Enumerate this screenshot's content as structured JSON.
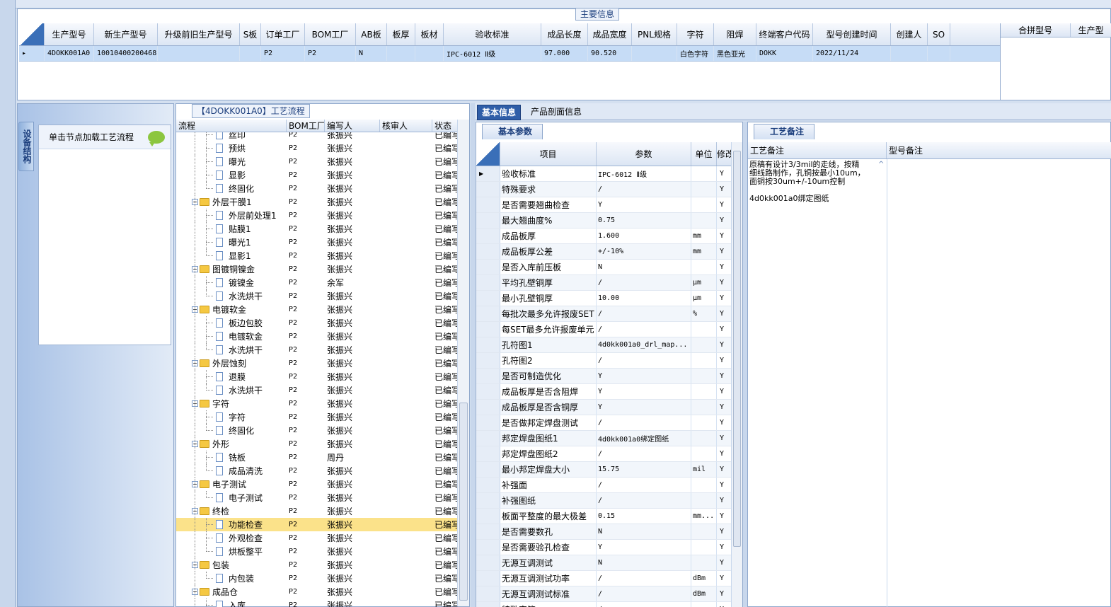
{
  "main_info": {
    "title": "主要信息",
    "columns": [
      "",
      "生产型号",
      "新生产型号",
      "升级前旧生产型号",
      "S板",
      "订单工厂",
      "BOM工厂",
      "AB板",
      "板厚",
      "板材",
      "验收标准",
      "成品长度",
      "成品宽度",
      "PNL规格",
      "字符",
      "阻焊",
      "终端客户代码",
      "型号创建时间",
      "创建人",
      "SO"
    ],
    "row": [
      "▸",
      "4DOKK001A0",
      "10010400200468",
      "",
      "",
      "P2",
      "P2",
      "N",
      "",
      "",
      "IPC-6012 Ⅱ级",
      "97.000",
      "90.520",
      "",
      "白色字符",
      "黑色亚光",
      "DOKK",
      "2022/11/24",
      "",
      ""
    ],
    "merge_columns": [
      "合拼型号",
      "生产型"
    ]
  },
  "device_structure": {
    "tab_label": "设备结构",
    "hint": "单击节点加载工艺流程"
  },
  "process": {
    "title": "【4DOKK001A0】工艺流程",
    "columns": [
      "流程",
      "BOM工厂",
      "编写人",
      "核审人",
      "状态"
    ],
    "rows": [
      {
        "name": "丝印",
        "level": 2,
        "type": "doc",
        "bom": "P2",
        "writer": "张振兴",
        "status": "已编写"
      },
      {
        "name": "预烘",
        "level": 2,
        "type": "doc",
        "bom": "P2",
        "writer": "张振兴",
        "status": "已编写"
      },
      {
        "name": "曝光",
        "level": 2,
        "type": "doc",
        "bom": "P2",
        "writer": "张振兴",
        "status": "已编写"
      },
      {
        "name": "显影",
        "level": 2,
        "type": "doc",
        "bom": "P2",
        "writer": "张振兴",
        "status": "已编写"
      },
      {
        "name": "终固化",
        "level": 2,
        "type": "doc",
        "last": true,
        "bom": "P2",
        "writer": "张振兴",
        "status": "已编写"
      },
      {
        "name": "外层干膜1",
        "level": 1,
        "type": "folder",
        "bom": "P2",
        "writer": "张振兴",
        "status": "已编写"
      },
      {
        "name": "外层前处理1",
        "level": 2,
        "type": "doc",
        "bom": "P2",
        "writer": "张振兴",
        "status": "已编写"
      },
      {
        "name": "贴膜1",
        "level": 2,
        "type": "doc",
        "bom": "P2",
        "writer": "张振兴",
        "status": "已编写"
      },
      {
        "name": "曝光1",
        "level": 2,
        "type": "doc",
        "bom": "P2",
        "writer": "张振兴",
        "status": "已编写"
      },
      {
        "name": "显影1",
        "level": 2,
        "type": "doc",
        "last": true,
        "bom": "P2",
        "writer": "张振兴",
        "status": "已编写"
      },
      {
        "name": "图镀铜镍金",
        "level": 1,
        "type": "folder",
        "bom": "P2",
        "writer": "张振兴",
        "status": "已编写"
      },
      {
        "name": "镀镍金",
        "level": 2,
        "type": "doc",
        "bom": "P2",
        "writer": "余军",
        "status": "已编写"
      },
      {
        "name": "水洗烘干",
        "level": 2,
        "type": "doc",
        "last": true,
        "bom": "P2",
        "writer": "张振兴",
        "status": "已编写"
      },
      {
        "name": "电镀软金",
        "level": 1,
        "type": "folder",
        "bom": "P2",
        "writer": "张振兴",
        "status": "已编写"
      },
      {
        "name": "板边包胶",
        "level": 2,
        "type": "doc",
        "bom": "P2",
        "writer": "张振兴",
        "status": "已编写"
      },
      {
        "name": "电镀软金",
        "level": 2,
        "type": "doc",
        "bom": "P2",
        "writer": "张振兴",
        "status": "已编写"
      },
      {
        "name": "水洗烘干",
        "level": 2,
        "type": "doc",
        "last": true,
        "bom": "P2",
        "writer": "张振兴",
        "status": "已编写"
      },
      {
        "name": "外层蚀刻",
        "level": 1,
        "type": "folder",
        "bom": "P2",
        "writer": "张振兴",
        "status": "已编写"
      },
      {
        "name": "退膜",
        "level": 2,
        "type": "doc",
        "bom": "P2",
        "writer": "张振兴",
        "status": "已编写"
      },
      {
        "name": "水洗烘干",
        "level": 2,
        "type": "doc",
        "last": true,
        "bom": "P2",
        "writer": "张振兴",
        "status": "已编写"
      },
      {
        "name": "字符",
        "level": 1,
        "type": "folder",
        "bom": "P2",
        "writer": "张振兴",
        "status": "已编写"
      },
      {
        "name": "字符",
        "level": 2,
        "type": "doc",
        "bom": "P2",
        "writer": "张振兴",
        "status": "已编写"
      },
      {
        "name": "终固化",
        "level": 2,
        "type": "doc",
        "last": true,
        "bom": "P2",
        "writer": "张振兴",
        "status": "已编写"
      },
      {
        "name": "外形",
        "level": 1,
        "type": "folder",
        "bom": "P2",
        "writer": "张振兴",
        "status": "已编写"
      },
      {
        "name": "铣板",
        "level": 2,
        "type": "doc",
        "bom": "P2",
        "writer": "周丹",
        "status": "已编写"
      },
      {
        "name": "成品清洗",
        "level": 2,
        "type": "doc",
        "last": true,
        "bom": "P2",
        "writer": "张振兴",
        "status": "已编写"
      },
      {
        "name": "电子测试",
        "level": 1,
        "type": "folder",
        "bom": "P2",
        "writer": "张振兴",
        "status": "已编写"
      },
      {
        "name": "电子测试",
        "level": 2,
        "type": "doc",
        "last": true,
        "bom": "P2",
        "writer": "张振兴",
        "status": "已编写"
      },
      {
        "name": "终检",
        "level": 1,
        "type": "folder",
        "bom": "P2",
        "writer": "张振兴",
        "status": "已编写"
      },
      {
        "name": "功能检查",
        "level": 2,
        "type": "doc",
        "selected": true,
        "bom": "P2",
        "writer": "张振兴",
        "status": "已编写"
      },
      {
        "name": "外观检查",
        "level": 2,
        "type": "doc",
        "bom": "P2",
        "writer": "张振兴",
        "status": "已编写"
      },
      {
        "name": "烘板整平",
        "level": 2,
        "type": "doc",
        "last": true,
        "bom": "P2",
        "writer": "张振兴",
        "status": "已编写"
      },
      {
        "name": "包装",
        "level": 1,
        "type": "folder",
        "bom": "P2",
        "writer": "张振兴",
        "status": "已编写"
      },
      {
        "name": "内包装",
        "level": 2,
        "type": "doc",
        "last": true,
        "bom": "P2",
        "writer": "张振兴",
        "status": "已编写"
      },
      {
        "name": "成品仓",
        "level": 1,
        "type": "folder",
        "bom": "P2",
        "writer": "张振兴",
        "status": "已编写"
      },
      {
        "name": "入库",
        "level": 2,
        "type": "doc",
        "bom": "P2",
        "writer": "张振兴",
        "status": "已编写"
      }
    ]
  },
  "right_tabs": [
    "基本信息",
    "产品剖面信息"
  ],
  "params": {
    "group_title": "基本参数",
    "columns": [
      "项目",
      "参数",
      "单位",
      "修改"
    ],
    "rows": [
      {
        "item": "验收标准",
        "value": "IPC-6012 Ⅱ级",
        "unit": "",
        "mod": "Y",
        "current": true
      },
      {
        "item": "特殊要求",
        "value": "/",
        "unit": "",
        "mod": "Y"
      },
      {
        "item": "是否需要翘曲检查",
        "value": "Y",
        "unit": "",
        "mod": "Y"
      },
      {
        "item": "最大翘曲度%",
        "value": "0.75",
        "unit": "",
        "mod": "Y"
      },
      {
        "item": "成品板厚",
        "value": "1.600",
        "unit": "mm",
        "mod": "Y"
      },
      {
        "item": "成品板厚公差",
        "value": "+/-10%",
        "unit": "mm",
        "mod": "Y"
      },
      {
        "item": "是否入库前压板",
        "value": "N",
        "unit": "",
        "mod": "Y"
      },
      {
        "item": "平均孔壁铜厚",
        "value": "/",
        "unit": "μm",
        "mod": "Y"
      },
      {
        "item": "最小孔壁铜厚",
        "value": "10.00",
        "unit": "μm",
        "mod": "Y"
      },
      {
        "item": "每批次最多允许报废SET",
        "value": "/",
        "unit": "%",
        "mod": "Y"
      },
      {
        "item": "每SET最多允许报废单元",
        "value": "/",
        "unit": "",
        "mod": "Y"
      },
      {
        "item": "孔符图1",
        "value": "4d0kk001a0_drl_map...",
        "unit": "",
        "mod": "Y"
      },
      {
        "item": "孔符图2",
        "value": "/",
        "unit": "",
        "mod": "Y"
      },
      {
        "item": "是否可制造优化",
        "value": "Y",
        "unit": "",
        "mod": "Y"
      },
      {
        "item": "成品板厚是否含阻焊",
        "value": "Y",
        "unit": "",
        "mod": "Y"
      },
      {
        "item": "成品板厚是否含铜厚",
        "value": "Y",
        "unit": "",
        "mod": "Y"
      },
      {
        "item": "是否做邦定焊盘测试",
        "value": "/",
        "unit": "",
        "mod": "Y"
      },
      {
        "item": "邦定焊盘图纸1",
        "value": "4d0kk001a0绑定图纸",
        "unit": "",
        "mod": "Y"
      },
      {
        "item": "邦定焊盘图纸2",
        "value": "/",
        "unit": "",
        "mod": "Y"
      },
      {
        "item": "最小邦定焊盘大小",
        "value": "15.75",
        "unit": "mil",
        "mod": "Y"
      },
      {
        "item": "补强面",
        "value": "/",
        "unit": "",
        "mod": "Y"
      },
      {
        "item": "补强图纸",
        "value": "/",
        "unit": "",
        "mod": "Y"
      },
      {
        "item": "板面平整度的最大极差",
        "value": "0.15",
        "unit": "mm...",
        "mod": "Y"
      },
      {
        "item": "是否需要数孔",
        "value": "N",
        "unit": "",
        "mod": "Y"
      },
      {
        "item": "是否需要验孔检查",
        "value": "Y",
        "unit": "",
        "mod": "Y"
      },
      {
        "item": "无源互调测试",
        "value": "N",
        "unit": "",
        "mod": "Y"
      },
      {
        "item": "无源互调测试功率",
        "value": "/",
        "unit": "dBm",
        "mod": "Y"
      },
      {
        "item": "无源互调测试标准",
        "value": "/",
        "unit": "dBm",
        "mod": "Y"
      },
      {
        "item": "特殊字符",
        "value": "/",
        "unit": "",
        "mod": "Y"
      }
    ]
  },
  "remarks": {
    "group_title": "工艺备注",
    "columns": [
      "工艺备注",
      "型号备注"
    ],
    "process_note": "原稿有设计3/3mil的走线，按精\n细线路制作，孔铜按最小10um，\n面铜按30um+/-10um控制\n\n4d0kk001a0绑定图纸"
  }
}
